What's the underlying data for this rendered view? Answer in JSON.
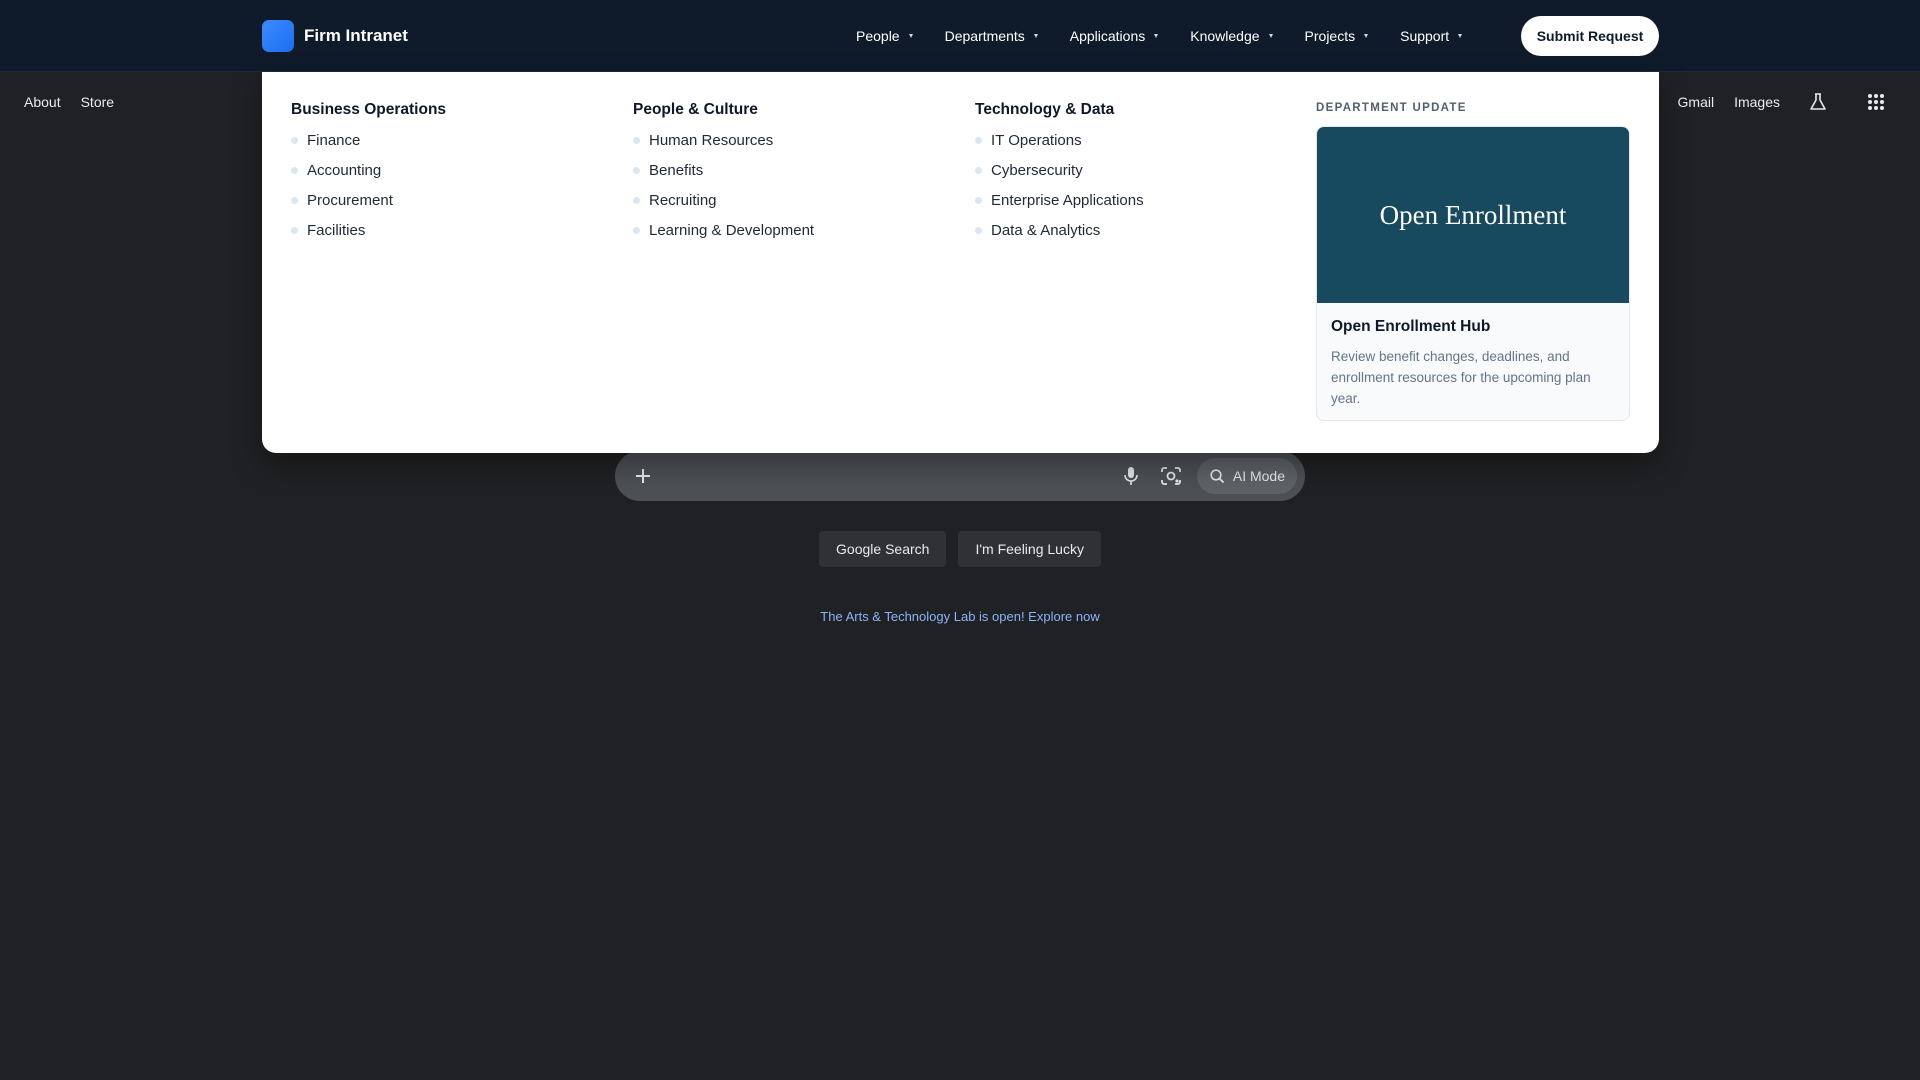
{
  "intranet": {
    "brand": "Firm Intranet",
    "nav": [
      {
        "label": "People"
      },
      {
        "label": "Departments"
      },
      {
        "label": "Applications"
      },
      {
        "label": "Knowledge"
      },
      {
        "label": "Projects"
      },
      {
        "label": "Support"
      }
    ],
    "submit_label": "Submit Request",
    "mega_menu": {
      "columns": [
        {
          "title": "Business Operations",
          "items": [
            "Finance",
            "Accounting",
            "Procurement",
            "Facilities"
          ]
        },
        {
          "title": "People & Culture",
          "items": [
            "Human Resources",
            "Benefits",
            "Recruiting",
            "Learning & Development"
          ]
        },
        {
          "title": "Technology & Data",
          "items": [
            "IT Operations",
            "Cybersecurity",
            "Enterprise Applications",
            "Data & Analytics"
          ]
        }
      ],
      "promo": {
        "eyebrow": "DEPARTMENT UPDATE",
        "image_text": "Open Enrollment",
        "title": "Open Enrollment Hub",
        "description": "Review benefit changes, deadlines, and enrollment resources for the upcoming plan year."
      }
    }
  },
  "google": {
    "top_left": {
      "about": "About",
      "store": "Store"
    },
    "top_right": {
      "gmail": "Gmail",
      "images": "Images",
      "labs_icon": "flask-icon",
      "apps_icon": "apps-grid-icon"
    },
    "search": {
      "placeholder": "",
      "ai_mode_label": "AI Mode"
    },
    "buttons": {
      "search": "Google Search",
      "lucky": "I'm Feeling Lucky"
    },
    "promo_text": "The Arts & Technology Lab is open! Explore now"
  },
  "colors": {
    "page_bg": "#202124",
    "header_bg": "#0f1a2b",
    "promo_image_bg": "#174a5e",
    "link_blue": "#8ab4f8"
  }
}
